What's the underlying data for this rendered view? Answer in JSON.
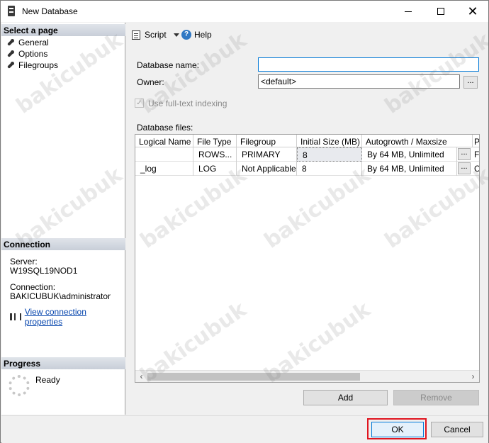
{
  "window": {
    "title": "New Database",
    "close_glyph": "✕"
  },
  "sidebar": {
    "select_page_header": "Select a page",
    "pages": [
      {
        "label": "General",
        "icon": "wrench-icon"
      },
      {
        "label": "Options",
        "icon": "wrench-icon"
      },
      {
        "label": "Filegroups",
        "icon": "wrench-icon"
      }
    ],
    "connection_header": "Connection",
    "server_label": "Server:",
    "server_value": "W19SQL19NOD1",
    "connection_label": "Connection:",
    "connection_value": "BAKICUBUK\\administrator",
    "view_connection_link": "View connection properties",
    "progress_header": "Progress",
    "progress_status": "Ready"
  },
  "toolbar": {
    "script_label": "Script",
    "help_label": "Help",
    "help_glyph": "?"
  },
  "general": {
    "database_name_label": "Database name:",
    "database_name_value": "",
    "owner_label": "Owner:",
    "owner_value": "<default>",
    "browse_label": "...",
    "fulltext_label": "Use full-text indexing",
    "fulltext_checked": true,
    "check_glyph": "✓",
    "database_files_label": "Database files:"
  },
  "files_grid": {
    "columns": [
      "Logical Name",
      "File Type",
      "Filegroup",
      "Initial Size (MB)",
      "Autogrowth / Maxsize",
      "P"
    ],
    "rows": [
      {
        "logical_name": "",
        "file_type": "ROWS...",
        "filegroup": "PRIMARY",
        "initial_size": "8",
        "autogrowth": "By 64 MB, Unlimited",
        "cell_button": "...",
        "path": "F"
      },
      {
        "logical_name": "_log",
        "file_type": "LOG",
        "filegroup": "Not Applicable",
        "initial_size": "8",
        "autogrowth": "By 64 MB, Unlimited",
        "cell_button": "...",
        "path": "C"
      }
    ],
    "scroll_left_glyph": "‹",
    "scroll_right_glyph": "›"
  },
  "grid_buttons": {
    "add_label": "Add",
    "remove_label": "Remove"
  },
  "footer": {
    "ok_label": "OK",
    "cancel_label": "Cancel"
  },
  "watermark": "bakicubuk"
}
